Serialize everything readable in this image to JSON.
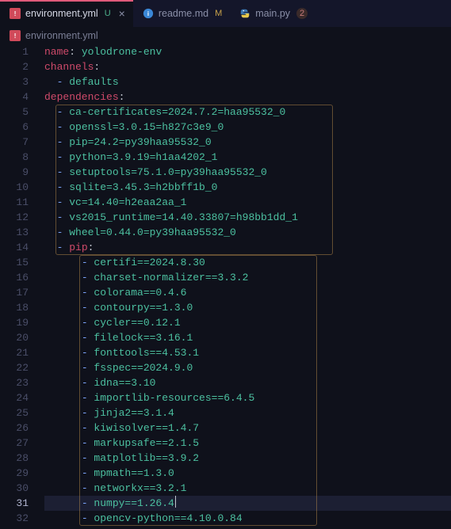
{
  "tabs": [
    {
      "icon": "yaml",
      "label": "environment.yml",
      "status": "U",
      "statusClass": "status-u",
      "active": true,
      "closable": true
    },
    {
      "icon": "md",
      "label": "readme.md",
      "status": "M",
      "statusClass": "status-m",
      "active": false,
      "closable": false
    },
    {
      "icon": "py",
      "label": "main.py",
      "status": "2",
      "statusClass": "status-2",
      "active": false,
      "closable": false
    }
  ],
  "breadcrumb": {
    "icon": "yaml",
    "label": "environment.yml"
  },
  "yaml": {
    "name_key": "name",
    "name_val": "yolodrone-env",
    "channels_key": "channels",
    "channels_item": "defaults",
    "dependencies_key": "dependencies",
    "deps": [
      "ca-certificates=2024.7.2=haa95532_0",
      "openssl=3.0.15=h827c3e9_0",
      "pip=24.2=py39haa95532_0",
      "python=3.9.19=h1aa4202_1",
      "setuptools=75.1.0=py39haa95532_0",
      "sqlite=3.45.3=h2bbff1b_0",
      "vc=14.40=h2eaa2aa_1",
      "vs2015_runtime=14.40.33807=h98bb1dd_1",
      "wheel=0.44.0=py39haa95532_0"
    ],
    "pip_key": "pip",
    "pip_deps": [
      "certifi==2024.8.30",
      "charset-normalizer==3.3.2",
      "colorama==0.4.6",
      "contourpy==1.3.0",
      "cycler==0.12.1",
      "filelock==3.16.1",
      "fonttools==4.53.1",
      "fsspec==2024.9.0",
      "idna==3.10",
      "importlib-resources==6.4.5",
      "jinja2==3.1.4",
      "kiwisolver==1.4.7",
      "markupsafe==2.1.5",
      "matplotlib==3.9.2",
      "mpmath==1.3.0",
      "networkx==3.2.1",
      "numpy==1.26.4",
      "opencv-python==4.10.0.84"
    ]
  },
  "currentLine": 31
}
